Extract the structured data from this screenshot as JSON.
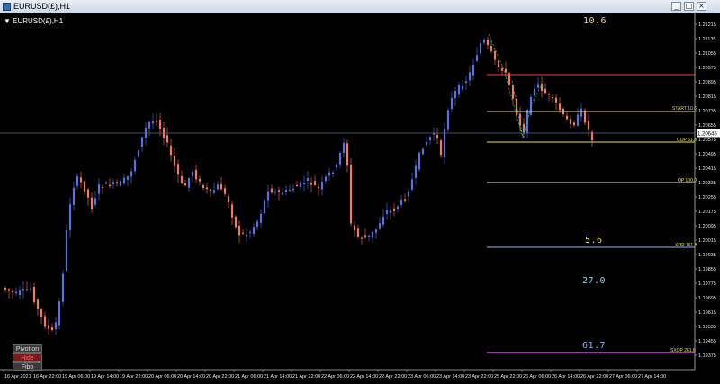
{
  "window": {
    "title": "EURUSD(£),H1",
    "min_glyph": "_",
    "max_glyph": "□",
    "close_glyph": "×"
  },
  "chart": {
    "symbol_label": "▼ EURUSD(£),H1",
    "current_price": "1.20645",
    "price_labels": [
      "1.21215",
      "1.21135",
      "1.21055",
      "1.20975",
      "1.20895",
      "1.20815",
      "1.20735",
      "1.20655",
      "1.20575",
      "1.20495",
      "1.20415",
      "1.20335",
      "1.20255",
      "1.20175",
      "1.20095",
      "1.20015",
      "1.19935",
      "1.19855",
      "1.19775",
      "1.19695",
      "1.19615",
      "1.19535",
      "1.19455",
      "1.19375"
    ],
    "time_labels": [
      "16 Apr 2021",
      "16 Apr 22:00",
      "19 Apr 06:00",
      "19 Apr 14:00",
      "19 Apr 22:00",
      "20 Apr 06:00",
      "20 Apr 14:00",
      "20 Apr 22:00",
      "21 Apr 06:00",
      "21 Apr 14:00",
      "21 Apr 22:00",
      "22 Apr 06:00",
      "22 Apr 14:00",
      "22 Apr 22:00",
      "23 Apr 06:00",
      "23 Apr 14:00",
      "23 Apr 22:00",
      "25 Apr 22:00",
      "26 Apr 06:00",
      "26 Apr 14:00",
      "26 Apr 22:00",
      "27 Apr 06:00",
      "27 Apr 14:00"
    ],
    "colors": {
      "bull": "#5b6fe0",
      "bear": "#f07b5e",
      "red_line": "#ff3a2a",
      "start_line": "#e9d78a",
      "cop_line": "#e9e64a",
      "op_line": "#f2f2f2",
      "xop_line": "#8fb3e8",
      "sxop_line": "#d04be6"
    }
  },
  "fib_levels": {
    "top_value": "10.6",
    "start_label": "START 10.6",
    "cop_label": "COP 61.8",
    "op_label": "OP 100.0",
    "xop_label": "XOP 161.8",
    "sxop_label": "SXOP 261.8",
    "val_5_6": "5.6",
    "val_27_0": "27.0",
    "val_61_7": "61.7"
  },
  "controls": {
    "pivot": "Pivot on",
    "hide": "Hide",
    "fibo": "Fibo"
  }
}
